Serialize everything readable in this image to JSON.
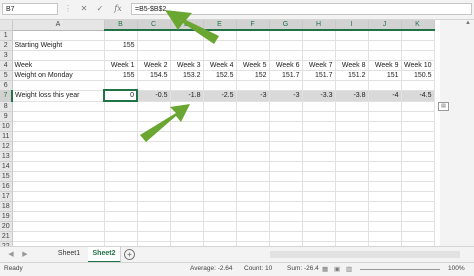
{
  "formula_bar": {
    "name_box": "B7",
    "cancel_glyph": "✕",
    "enter_glyph": "✓",
    "fx_label": "fx",
    "formula": "=B5-$B$2"
  },
  "columns": [
    "A",
    "B",
    "C",
    "D",
    "E",
    "F",
    "G",
    "H",
    "I",
    "J",
    "K"
  ],
  "rows": {
    "r2": {
      "label": "Starting Weight",
      "b": "155"
    },
    "r4": {
      "label": "Week",
      "values": [
        "Week 1",
        "Week 2",
        "Week 3",
        "Week 4",
        "Week 5",
        "Week 6",
        "Week 7",
        "Week 8",
        "Week 9",
        "Week 10"
      ]
    },
    "r5": {
      "label": "Weight on Monday",
      "values": [
        "155",
        "154.5",
        "153.2",
        "152.5",
        "152",
        "151.7",
        "151.7",
        "151.2",
        "151",
        "150.5"
      ]
    },
    "r7": {
      "label": "Weight loss this year",
      "values": [
        "0",
        "-0.5",
        "-1.8",
        "-2.5",
        "-3",
        "-3",
        "-3.3",
        "-3.8",
        "-4",
        "-4.5"
      ]
    }
  },
  "row_numbers": [
    "1",
    "2",
    "3",
    "4",
    "5",
    "6",
    "7",
    "8",
    "9",
    "10",
    "11",
    "12",
    "13",
    "14",
    "15",
    "16",
    "17",
    "18",
    "19",
    "20",
    "21",
    "22"
  ],
  "sheets": {
    "tab1": "Sheet1",
    "tab2": "Sheet2",
    "active": "Sheet2"
  },
  "status": {
    "ready": "Ready",
    "average": "Average: -2.64",
    "count": "Count: 10",
    "sum": "Sum: -26.4",
    "zoom": "100%"
  },
  "colors": {
    "accent": "#217346",
    "arrow": "#6aa632",
    "range_fill": "#d9d9d9"
  },
  "icons": [
    "cancel-icon",
    "enter-icon",
    "function-icon",
    "quick-analysis-icon",
    "add-sheet-icon",
    "arrow-annotation"
  ]
}
